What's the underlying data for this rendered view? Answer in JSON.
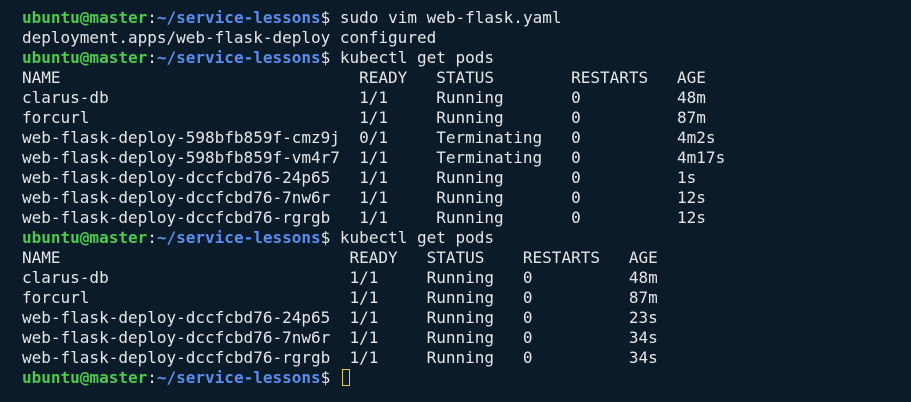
{
  "prompt": {
    "user_host": "ubuntu@master",
    "separator": ":",
    "path": "~/service-lessons",
    "symbol": "$"
  },
  "lines": [
    {
      "type": "prompt",
      "command": " sudo vim web-flask.yaml"
    },
    {
      "type": "output",
      "text": "deployment.apps/web-flask-deploy configured"
    },
    {
      "type": "prompt",
      "command": " kubectl get pods"
    },
    {
      "type": "output",
      "text": "NAME                               READY   STATUS        RESTARTS   AGE"
    },
    {
      "type": "output",
      "text": "clarus-db                          1/1     Running       0          48m"
    },
    {
      "type": "output",
      "text": "forcurl                            1/1     Running       0          87m"
    },
    {
      "type": "output",
      "text": "web-flask-deploy-598bfb859f-cmz9j  0/1     Terminating   0          4m2s"
    },
    {
      "type": "output",
      "text": "web-flask-deploy-598bfb859f-vm4r7  1/1     Terminating   0          4m17s"
    },
    {
      "type": "output",
      "text": "web-flask-deploy-dccfcbd76-24p65   1/1     Running       0          1s"
    },
    {
      "type": "output",
      "text": "web-flask-deploy-dccfcbd76-7nw6r   1/1     Running       0          12s"
    },
    {
      "type": "output",
      "text": "web-flask-deploy-dccfcbd76-rgrgb   1/1     Running       0          12s"
    },
    {
      "type": "prompt",
      "command": " kubectl get pods"
    },
    {
      "type": "output",
      "text": "NAME                              READY   STATUS    RESTARTS   AGE"
    },
    {
      "type": "output",
      "text": "clarus-db                         1/1     Running   0          48m"
    },
    {
      "type": "output",
      "text": "forcurl                           1/1     Running   0          87m"
    },
    {
      "type": "output",
      "text": "web-flask-deploy-dccfcbd76-24p65  1/1     Running   0          23s"
    },
    {
      "type": "output",
      "text": "web-flask-deploy-dccfcbd76-7nw6r  1/1     Running   0          34s"
    },
    {
      "type": "output",
      "text": "web-flask-deploy-dccfcbd76-rgrgb  1/1     Running   0          34s"
    },
    {
      "type": "prompt",
      "command": " ",
      "cursor": true
    }
  ],
  "colors": {
    "background": "#0c1b2a",
    "user_host": "#4ec94e",
    "path": "#5b8dee",
    "text": "#e6e6e6",
    "cursor": "#e6c84a"
  }
}
